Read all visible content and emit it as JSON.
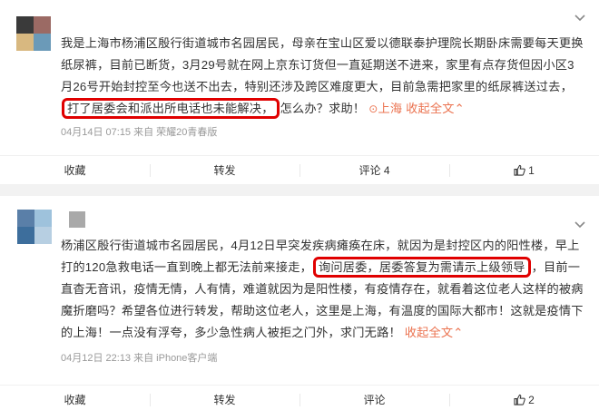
{
  "posts": [
    {
      "avatar_colors": [
        "#3a3a3a",
        "#9b6a64",
        "#d8b880",
        "#6b9ab8"
      ],
      "text_before": "我是上海市杨浦区殷行街道城市名园居民，母亲在宝山区爱以德联泰护理院长期卧床需要每天更换纸尿裤，目前已断货，3月29号就在网上京东订货但一直延期送不进来，家里有点存货但因小区3月26号开始封控至今也送不出去，特别还涉及跨区难度更大，目前急需把家里的纸尿裤送过去，",
      "highlight": "打了居委会和派出所电话也未能解决，",
      "text_after": "怎么办？求助！",
      "location": "上海",
      "location_icon": "location-pin",
      "expand": "收起全文",
      "meta": "04月14日 07:15  来自 荣耀20青春版",
      "actions": {
        "fav": "收藏",
        "repost": "转发",
        "comment": "评论 4",
        "like": "1"
      }
    },
    {
      "avatar_colors": [
        "#5a7fa8",
        "#9ec2dc",
        "#3d6e9c",
        "#b7cfe2"
      ],
      "text_before": "杨浦区殷行街道城市名园居民，4月12日早突发疾病瘫痪在床，就因为是封控区内的阳性楼，早上打的120急救电话一直到晚上都无法前来接走，",
      "highlight": "询问居委，居委答复为需请示上级领导",
      "text_after": "，目前一直杳无音讯，疫情无情，人有情，难道就因为是阳性楼，有疫情存在，就看着这位老人这样的被病魔折磨吗？希望各位进行转发，帮助这位老人，这里是上海，有温度的国际大都市！这就是疫情下的上海！一点没有浮夸，多少急性病人被拒之门外，求门无路！",
      "expand": "収起全文",
      "meta": "04月12日 22:13  来自 iPhone客户端",
      "actions": {
        "fav": "收藏",
        "repost": "转发",
        "comment": "评论",
        "like": "2"
      }
    }
  ],
  "colors": {
    "accent": "#eb7350",
    "highlight_border": "#e00000"
  }
}
